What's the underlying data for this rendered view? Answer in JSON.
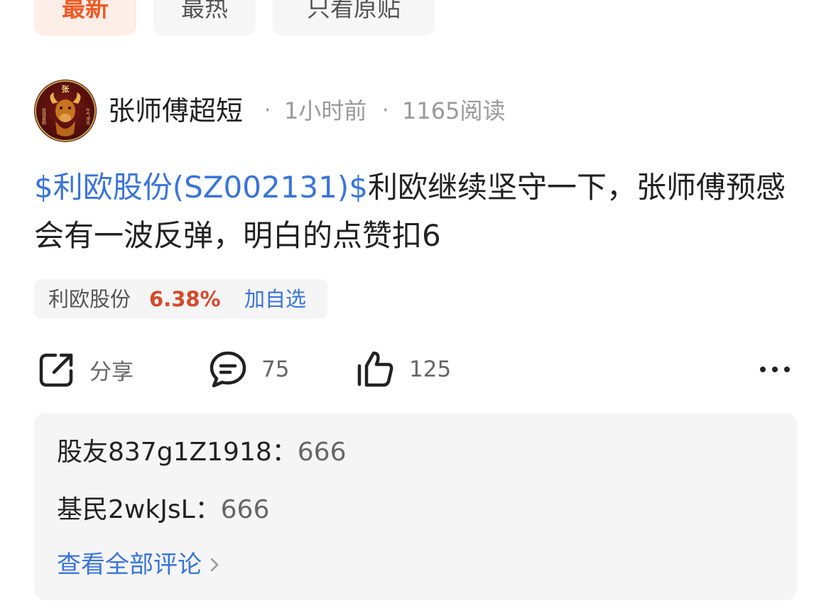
{
  "tabs": [
    {
      "label": "最新",
      "active": true
    },
    {
      "label": "最热",
      "active": false
    },
    {
      "label": "只看原贴",
      "active": false
    }
  ],
  "post": {
    "author": "张师傅超短",
    "avatar_text": "张",
    "avatar_side_left": "挂钱是帅",
    "avatar_side_right": "牛气冲天",
    "time": "1小时前",
    "reads": "1165阅读",
    "separator": "·",
    "stock_tag": "$利欧股份(SZ002131)$",
    "content": "利欧继续坚守一下，张师傅预感会有一波反弹，明白的点赞扣6"
  },
  "stock_chip": {
    "name": "利欧股份",
    "change": "6.38%",
    "add_label": "加自选"
  },
  "actions": {
    "share_label": "分享",
    "comment_count": "75",
    "like_count": "125"
  },
  "comments": {
    "items": [
      {
        "user": "股友837g1Z1918",
        "sep": "：",
        "text": "666"
      },
      {
        "user": "基民2wkJsL",
        "sep": "：",
        "text": "666"
      }
    ],
    "view_all": "查看全部评论"
  },
  "colors": {
    "accent_orange": "#ee5a24",
    "link_blue": "#3a74d8",
    "up_red": "#d44a2a"
  }
}
